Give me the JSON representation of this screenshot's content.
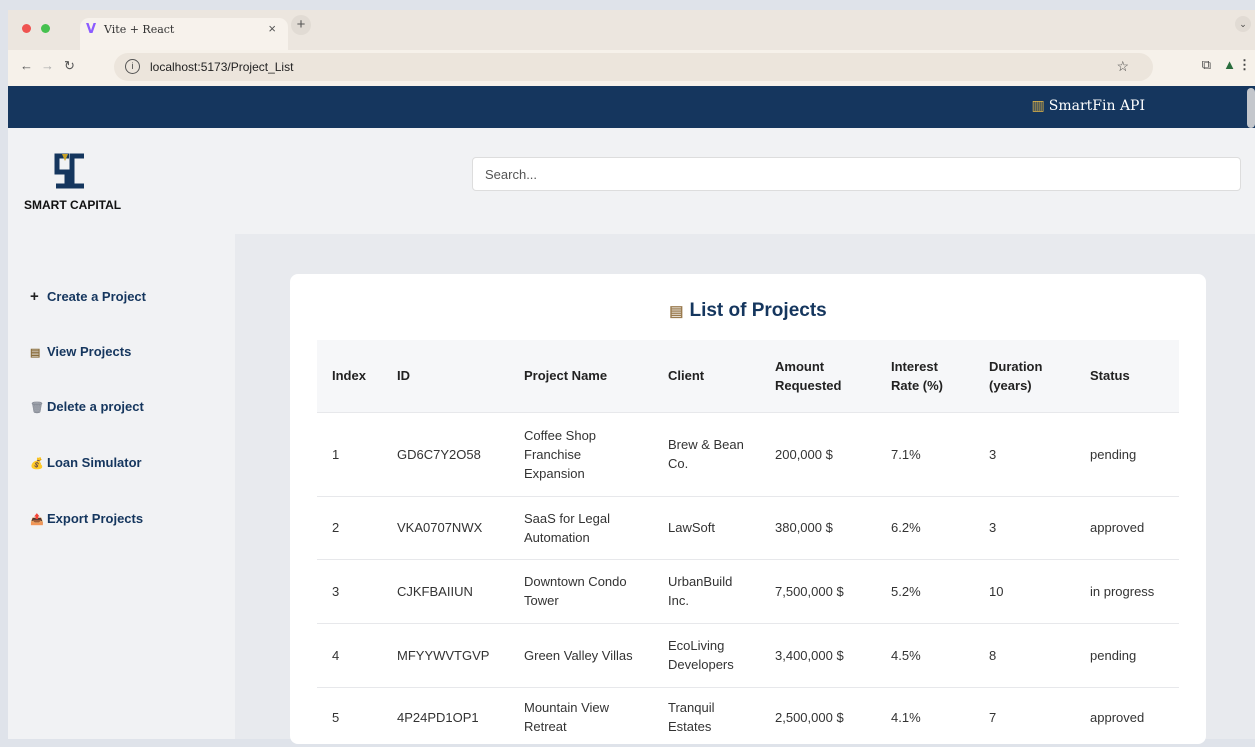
{
  "browser": {
    "tab_title": "Vite + React",
    "tab_close": "×",
    "new_tab": "+",
    "url": "localhost:5173/Project_List"
  },
  "header": {
    "brand": "SmartFin API",
    "brand_icon": "bank-icon"
  },
  "logo": {
    "text": "SMART CAPITAL",
    "colors": {
      "dark": "#15365e",
      "gold": "#c9a227"
    }
  },
  "search": {
    "placeholder": "Search..."
  },
  "sidebar": {
    "items": [
      {
        "icon": "+",
        "label": "Create a Project"
      },
      {
        "icon": "▤",
        "label": "View Projects"
      },
      {
        "icon": "🗑",
        "label": "Delete a project"
      },
      {
        "icon": "💰",
        "label": "Loan Simulator"
      },
      {
        "icon": "📤",
        "label": "Export Projects"
      }
    ]
  },
  "main": {
    "title": "List of Projects",
    "title_icon": "clipboard-icon",
    "columns": [
      "Index",
      "ID",
      "Project Name",
      "Client",
      "Amount Requested",
      "Interest Rate (%)",
      "Duration (years)",
      "Status"
    ],
    "rows": [
      {
        "index": "1",
        "id": "GD6C7Y2O58",
        "name": "Coffee Shop Franchise Expansion",
        "client": "Brew & Bean Co.",
        "amount": "200,000 $",
        "rate": "7.1%",
        "duration": "3",
        "status": "pending"
      },
      {
        "index": "2",
        "id": "VKA0707NWX",
        "name": "SaaS for Legal Automation",
        "client": "LawSoft",
        "amount": "380,000 $",
        "rate": "6.2%",
        "duration": "3",
        "status": "approved"
      },
      {
        "index": "3",
        "id": "CJKFBAIIUN",
        "name": "Downtown Condo Tower",
        "client": "UrbanBuild Inc.",
        "amount": "7,500,000 $",
        "rate": "5.2%",
        "duration": "10",
        "status": "in progress"
      },
      {
        "index": "4",
        "id": "MFYYWVTGVP",
        "name": "Green Valley Villas",
        "client": "EcoLiving Developers",
        "amount": "3,400,000 $",
        "rate": "4.5%",
        "duration": "8",
        "status": "pending"
      },
      {
        "index": "5",
        "id": "4P24PD1OP1",
        "name": "Mountain View Retreat",
        "client": "Tranquil Estates",
        "amount": "2,500,000 $",
        "rate": "4.1%",
        "duration": "7",
        "status": "approved"
      }
    ]
  },
  "colors": {
    "primary": "#15365e",
    "accent_gold": "#e6b847"
  }
}
